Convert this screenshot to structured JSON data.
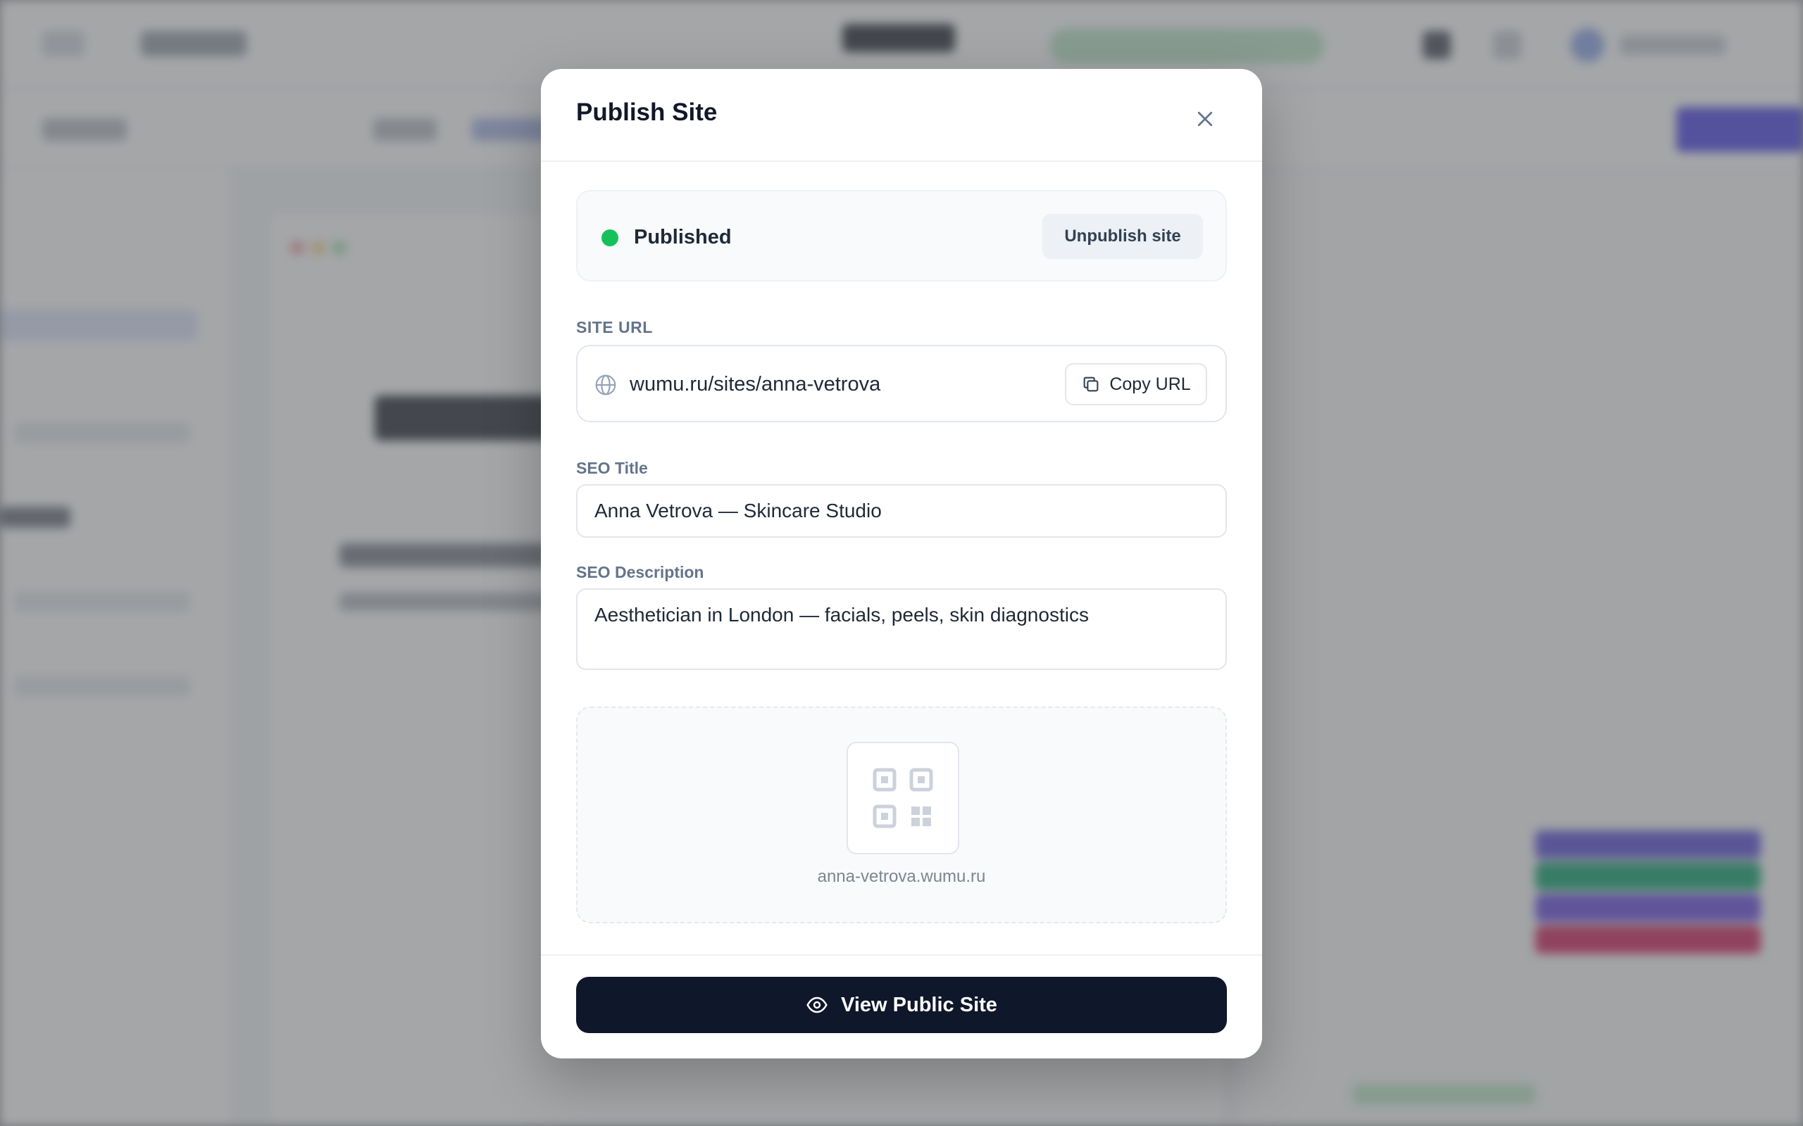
{
  "modal": {
    "title": "Publish Site",
    "status": {
      "label": "Published",
      "color": "#16c15a",
      "unpublish_label": "Unpublish site"
    },
    "site_url": {
      "label": "SITE URL",
      "value": "wumu.ru/sites/anna-vetrova",
      "icon": "globe-icon",
      "copy_label": "Copy URL",
      "copy_icon": "copy-icon"
    },
    "seo_title": {
      "label": "SEO Title",
      "value": "Anna Vetrova — Skincare Studio"
    },
    "seo_description": {
      "label": "SEO Description",
      "value": "Aesthetician in London — facials, peels, skin diagnostics"
    },
    "qr": {
      "icon": "qr-code-icon",
      "caption": "anna-vetrova.wumu.ru"
    },
    "footer": {
      "view_label": "View Public Site",
      "view_icon": "eye-icon"
    }
  },
  "colors": {
    "primary_button": "#0f172a",
    "published": "#16c15a",
    "background_accent": "#4f46e5"
  }
}
